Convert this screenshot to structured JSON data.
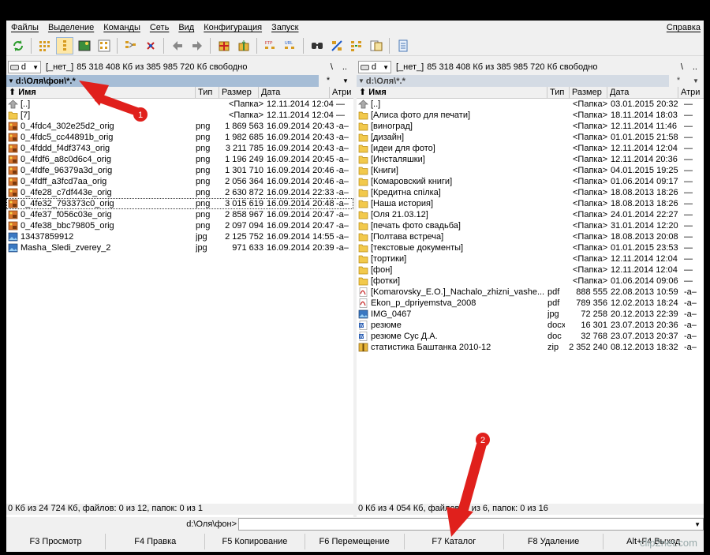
{
  "menu": [
    "Файлы",
    "Выделение",
    "Команды",
    "Сеть",
    "Вид",
    "Конфигурация",
    "Запуск"
  ],
  "menu_right": "Справка",
  "toolbar_icons": [
    "refresh-icon",
    "brief-view-icon",
    "full-view-icon",
    "thumbnail-view-icon",
    "tree-view-icon",
    "invert-selection-icon",
    "back-icon",
    "forward-icon",
    "pack-icon",
    "unpack-icon",
    "ftp-icon",
    "url-icon",
    "search-icon",
    "rename-icon",
    "sync-icon",
    "compare-icon",
    "notepad-icon"
  ],
  "columns": {
    "name": "Имя",
    "type": "Тип",
    "size": "Размер",
    "date": "Дата",
    "attr": "Атри"
  },
  "left": {
    "drive": "d",
    "label": "[_нет_]",
    "free": "85 318 408 Кб из 385 985 720 Кб свободно",
    "root_btn": "\\",
    "up_btn": "..",
    "path": "d:\\Оля\\фон\\*.*",
    "filter": "*",
    "files": [
      {
        "icon": "up-icon",
        "name": "[..]",
        "type": "",
        "size": "<Папка>",
        "date": "12.11.2014 12:04",
        "attr": "—"
      },
      {
        "icon": "folder-icon",
        "name": "[7]",
        "type": "",
        "size": "<Папка>",
        "date": "12.11.2014 12:04",
        "attr": "—"
      },
      {
        "icon": "png-icon",
        "name": "0_4fdc4_302e25d2_orig",
        "type": "png",
        "size": "1 869 563",
        "date": "16.09.2014 20:43",
        "attr": "-a–"
      },
      {
        "icon": "png-icon",
        "name": "0_4fdc5_cc44891b_orig",
        "type": "png",
        "size": "1 982 685",
        "date": "16.09.2014 20:43",
        "attr": "-a–"
      },
      {
        "icon": "png-icon",
        "name": "0_4fddd_f4df3743_orig",
        "type": "png",
        "size": "3 211 785",
        "date": "16.09.2014 20:43",
        "attr": "-a–"
      },
      {
        "icon": "png-icon",
        "name": "0_4fdf6_a8c0d6c4_orig",
        "type": "png",
        "size": "1 196 249",
        "date": "16.09.2014 20:45",
        "attr": "-a–"
      },
      {
        "icon": "png-icon",
        "name": "0_4fdfe_96379a3d_orig",
        "type": "png",
        "size": "1 301 710",
        "date": "16.09.2014 20:46",
        "attr": "-a–"
      },
      {
        "icon": "png-icon",
        "name": "0_4fdff_a3fcd7aa_orig",
        "type": "png",
        "size": "2 056 364",
        "date": "16.09.2014 20:46",
        "attr": "-a–"
      },
      {
        "icon": "png-icon",
        "name": "0_4fe28_c7df443e_orig",
        "type": "png",
        "size": "2 630 872",
        "date": "16.09.2014 22:33",
        "attr": "-a–"
      },
      {
        "icon": "png-icon",
        "name": "0_4fe32_793373c0_orig",
        "type": "png",
        "size": "3 015 619",
        "date": "16.09.2014 20:48",
        "attr": "-a–",
        "cursor": true
      },
      {
        "icon": "png-icon",
        "name": "0_4fe37_f056c03e_orig",
        "type": "png",
        "size": "2 858 967",
        "date": "16.09.2014 20:47",
        "attr": "-a–"
      },
      {
        "icon": "png-icon",
        "name": "0_4fe38_bbc79805_orig",
        "type": "png",
        "size": "2 097 094",
        "date": "16.09.2014 20:47",
        "attr": "-a–"
      },
      {
        "icon": "jpg-icon",
        "name": "13437859912",
        "type": "jpg",
        "size": "2 125 752",
        "date": "16.09.2014 14:55",
        "attr": "-a–"
      },
      {
        "icon": "jpg-icon",
        "name": "Masha_Sledi_zverey_2",
        "type": "jpg",
        "size": "971 633",
        "date": "16.09.2014 20:39",
        "attr": "-a–"
      }
    ],
    "status": "0 Кб из 24 724 Кб, файлов: 0 из 12, папок: 0 из 1"
  },
  "right": {
    "drive": "d",
    "label": "[_нет_]",
    "free": "85 318 408 Кб из 385 985 720 Кб свободно",
    "root_btn": "\\",
    "up_btn": "..",
    "path": "d:\\Оля\\*.*",
    "filter": "*",
    "files": [
      {
        "icon": "up-icon",
        "name": "[..]",
        "type": "",
        "size": "<Папка>",
        "date": "03.01.2015 20:32",
        "attr": "—"
      },
      {
        "icon": "folder-icon",
        "name": "[Алиса фото для печати]",
        "type": "",
        "size": "<Папка>",
        "date": "18.11.2014 18:03",
        "attr": "—"
      },
      {
        "icon": "folder-icon",
        "name": "[виноград]",
        "type": "",
        "size": "<Папка>",
        "date": "12.11.2014 11:46",
        "attr": "—"
      },
      {
        "icon": "folder-icon",
        "name": "[дизайн]",
        "type": "",
        "size": "<Папка>",
        "date": "01.01.2015 21:58",
        "attr": "—"
      },
      {
        "icon": "folder-icon",
        "name": "[идеи для фото]",
        "type": "",
        "size": "<Папка>",
        "date": "12.11.2014 12:04",
        "attr": "—"
      },
      {
        "icon": "folder-icon",
        "name": "[Инсталяшки]",
        "type": "",
        "size": "<Папка>",
        "date": "12.11.2014 20:36",
        "attr": "—"
      },
      {
        "icon": "folder-icon",
        "name": "[Книги]",
        "type": "",
        "size": "<Папка>",
        "date": "04.01.2015 19:25",
        "attr": "—"
      },
      {
        "icon": "folder-icon",
        "name": "[Комаровский книги]",
        "type": "",
        "size": "<Папка>",
        "date": "01.06.2014 09:17",
        "attr": "—"
      },
      {
        "icon": "folder-icon",
        "name": "[Кредитна спілка]",
        "type": "",
        "size": "<Папка>",
        "date": "18.08.2013 18:26",
        "attr": "—"
      },
      {
        "icon": "folder-icon",
        "name": "[Наша история]",
        "type": "",
        "size": "<Папка>",
        "date": "18.08.2013 18:26",
        "attr": "—"
      },
      {
        "icon": "folder-icon",
        "name": "[Оля 21.03.12]",
        "type": "",
        "size": "<Папка>",
        "date": "24.01.2014 22:27",
        "attr": "—"
      },
      {
        "icon": "folder-icon",
        "name": "[печать фото свадьба]",
        "type": "",
        "size": "<Папка>",
        "date": "31.01.2014 12:20",
        "attr": "—"
      },
      {
        "icon": "folder-icon",
        "name": "[Полтава встреча]",
        "type": "",
        "size": "<Папка>",
        "date": "18.08.2013 20:08",
        "attr": "—"
      },
      {
        "icon": "folder-icon",
        "name": "[текстовые документы]",
        "type": "",
        "size": "<Папка>",
        "date": "01.01.2015 23:53",
        "attr": "—"
      },
      {
        "icon": "folder-icon",
        "name": "[тортики]",
        "type": "",
        "size": "<Папка>",
        "date": "12.11.2014 12:04",
        "attr": "—"
      },
      {
        "icon": "folder-icon",
        "name": "[фон]",
        "type": "",
        "size": "<Папка>",
        "date": "12.11.2014 12:04",
        "attr": "—"
      },
      {
        "icon": "folder-icon",
        "name": "[фотки]",
        "type": "",
        "size": "<Папка>",
        "date": "01.06.2014 09:06",
        "attr": "—"
      },
      {
        "icon": "pdf-icon",
        "name": "[Komarovsky_E.O.]_Nachalo_zhizni_vashe...",
        "type": "pdf",
        "size": "888 555",
        "date": "22.08.2013 10:59",
        "attr": "-a–"
      },
      {
        "icon": "pdf-icon",
        "name": "Ekon_p_dpriyemstva_2008",
        "type": "pdf",
        "size": "789 356",
        "date": "12.02.2013 18:24",
        "attr": "-a–"
      },
      {
        "icon": "jpg-icon",
        "name": "IMG_0467",
        "type": "jpg",
        "size": "72 258",
        "date": "20.12.2013 22:39",
        "attr": "-a–"
      },
      {
        "icon": "word-icon",
        "name": "резюме",
        "type": "docx",
        "size": "16 301",
        "date": "23.07.2013 20:36",
        "attr": "-a–"
      },
      {
        "icon": "word-icon",
        "name": "резюме Сус Д.А.",
        "type": "doc",
        "size": "32 768",
        "date": "23.07.2013 20:37",
        "attr": "-a–"
      },
      {
        "icon": "zip-icon",
        "name": "статистика Баштанка 2010-12",
        "type": "zip",
        "size": "2 352 240",
        "date": "08.12.2013 18:32",
        "attr": "-a–"
      }
    ],
    "status": "0 Кб из 4 054 Кб, файлов: 0 из 6, папок: 0 из 16"
  },
  "cmdline": {
    "path": "d:\\Оля\\фон>"
  },
  "fkeys": [
    "F3 Просмотр",
    "F4 Правка",
    "F5 Копирование",
    "F6 Перемещение",
    "F7 Каталог",
    "F8 Удаление",
    "Alt+F4 Выход"
  ],
  "annotations": [
    {
      "label": "1",
      "color": "#e0201c"
    },
    {
      "label": "2",
      "color": "#e0201c"
    }
  ],
  "watermark": "clip2net.com"
}
